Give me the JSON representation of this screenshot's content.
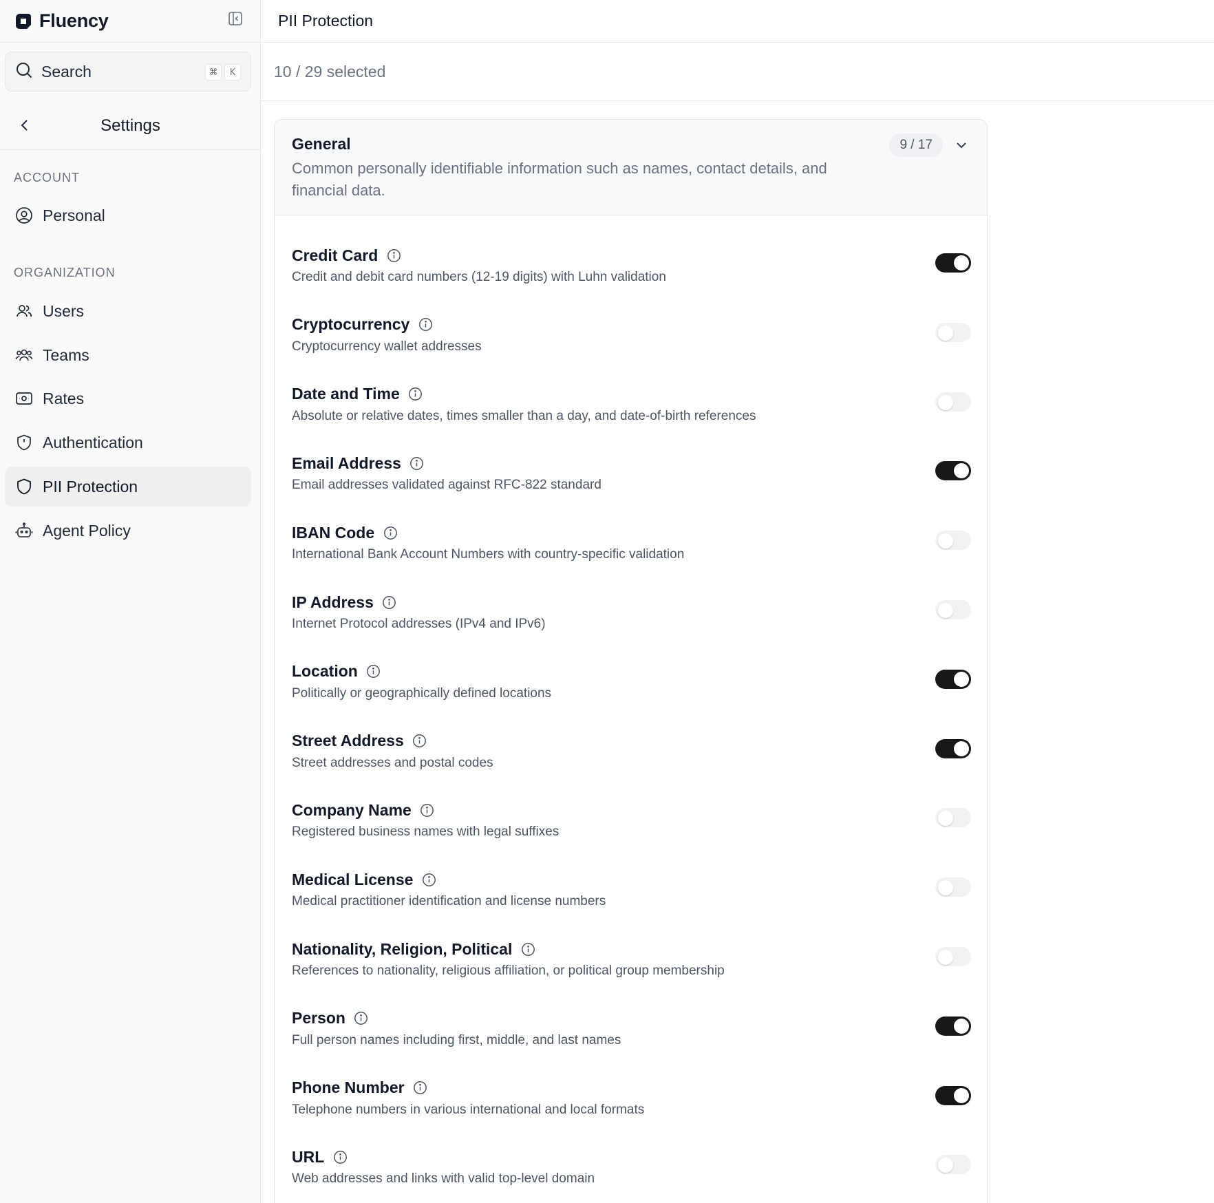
{
  "app": {
    "name": "Fluency"
  },
  "sidebar": {
    "search": {
      "label": "Search",
      "shortcut": [
        "⌘",
        "K"
      ]
    },
    "back_title": "Settings",
    "sections": [
      {
        "label": "ACCOUNT",
        "items": [
          {
            "label": "Personal",
            "icon": "user-circle-icon",
            "active": false
          }
        ]
      },
      {
        "label": "ORGANIZATION",
        "items": [
          {
            "label": "Users",
            "icon": "users-icon",
            "active": false
          },
          {
            "label": "Teams",
            "icon": "teams-icon",
            "active": false
          },
          {
            "label": "Rates",
            "icon": "rates-icon",
            "active": false
          },
          {
            "label": "Authentication",
            "icon": "shield-icon",
            "active": false
          },
          {
            "label": "PII Protection",
            "icon": "shield-icon",
            "active": true
          },
          {
            "label": "Agent Policy",
            "icon": "robot-icon",
            "active": false
          }
        ]
      }
    ]
  },
  "header": {
    "title": "PII Protection"
  },
  "selection": {
    "count_text": "10 / 29 selected"
  },
  "group": {
    "title": "General",
    "description": "Common personally identifiable information such as names, contact details, and financial data.",
    "badge": "9 / 17",
    "items": [
      {
        "title": "Credit Card",
        "description": "Credit and debit card numbers (12-19 digits) with Luhn validation",
        "enabled": true
      },
      {
        "title": "Cryptocurrency",
        "description": "Cryptocurrency wallet addresses",
        "enabled": false
      },
      {
        "title": "Date and Time",
        "description": "Absolute or relative dates, times smaller than a day, and date-of-birth references",
        "enabled": false
      },
      {
        "title": "Email Address",
        "description": "Email addresses validated against RFC-822 standard",
        "enabled": true
      },
      {
        "title": "IBAN Code",
        "description": "International Bank Account Numbers with country-specific validation",
        "enabled": false
      },
      {
        "title": "IP Address",
        "description": "Internet Protocol addresses (IPv4 and IPv6)",
        "enabled": false
      },
      {
        "title": "Location",
        "description": "Politically or geographically defined locations",
        "enabled": true
      },
      {
        "title": "Street Address",
        "description": "Street addresses and postal codes",
        "enabled": true
      },
      {
        "title": "Company Name",
        "description": "Registered business names with legal suffixes",
        "enabled": false
      },
      {
        "title": "Medical License",
        "description": "Medical practitioner identification and license numbers",
        "enabled": false
      },
      {
        "title": "Nationality, Religion, Political",
        "description": "References to nationality, religious affiliation, or political group membership",
        "enabled": false
      },
      {
        "title": "Person",
        "description": "Full person names including first, middle, and last names",
        "enabled": true
      },
      {
        "title": "Phone Number",
        "description": "Telephone numbers in various international and local formats",
        "enabled": true
      },
      {
        "title": "URL",
        "description": "Web addresses and links with valid top-level domain",
        "enabled": false
      }
    ]
  },
  "colors": {
    "toggle_on": "#18181b",
    "toggle_off": "#f1f2f4",
    "active_nav": "#efefef"
  }
}
